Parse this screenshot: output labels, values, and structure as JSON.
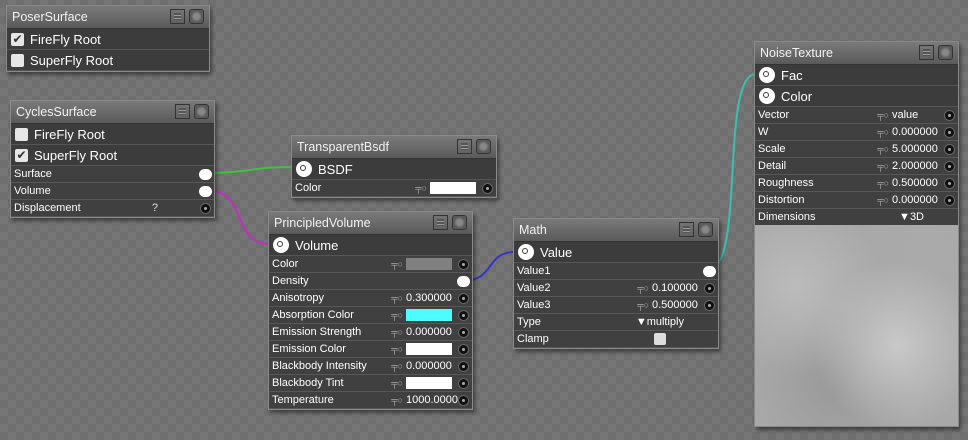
{
  "nodes": [
    {
      "title": "PoserSurface",
      "headers": [
        {
          "type": "checkbox",
          "label": "FireFly Root",
          "checked": true
        },
        {
          "type": "checkbox",
          "label": "SuperFly Root",
          "checked": false
        }
      ],
      "params": []
    },
    {
      "title": "CyclesSurface",
      "headers": [
        {
          "type": "checkbox",
          "label": "FireFly Root",
          "checked": false
        },
        {
          "type": "checkbox",
          "label": "SuperFly Root",
          "checked": true
        }
      ],
      "params": [
        {
          "label": "Surface",
          "socket": "output"
        },
        {
          "label": "Volume",
          "socket": "output"
        },
        {
          "label": "Displacement",
          "help": "?",
          "socket": "input"
        }
      ]
    },
    {
      "title": "TransparentBsdf",
      "headers": [
        {
          "type": "output",
          "label": "BSDF"
        }
      ],
      "params": [
        {
          "label": "Color",
          "key": true,
          "swatch": "#ffffff",
          "socket": "input"
        }
      ]
    },
    {
      "title": "PrincipledVolume",
      "headers": [
        {
          "type": "output",
          "label": "Volume"
        }
      ],
      "params": [
        {
          "label": "Color",
          "key": true,
          "swatch": "#808080",
          "socket": "input"
        },
        {
          "label": "Density",
          "socket": "output"
        },
        {
          "label": "Anisotropy",
          "key": true,
          "value": "0.300000",
          "socket": "input"
        },
        {
          "label": "Absorption Color",
          "key": true,
          "swatch": "#4dfcff",
          "socket": "input"
        },
        {
          "label": "Emission Strength",
          "key": true,
          "value": "0.000000",
          "socket": "input"
        },
        {
          "label": "Emission Color",
          "key": true,
          "swatch": "#ffffff",
          "socket": "input"
        },
        {
          "label": "Blackbody Intensity",
          "key": true,
          "value": "0.000000",
          "socket": "input"
        },
        {
          "label": "Blackbody Tint",
          "key": true,
          "swatch": "#ffffff",
          "socket": "input"
        },
        {
          "label": "Temperature",
          "key": true,
          "value": "1000.0000",
          "socket": "input"
        }
      ]
    },
    {
      "title": "Math",
      "headers": [
        {
          "type": "output",
          "label": "Value"
        }
      ],
      "params": [
        {
          "label": "Value1",
          "socket": "output"
        },
        {
          "label": "Value2",
          "key": true,
          "value": "0.100000",
          "socket": "input"
        },
        {
          "label": "Value3",
          "key": true,
          "value": "0.500000",
          "socket": "input"
        },
        {
          "label": "Type",
          "dropdown": "multiply"
        },
        {
          "label": "Clamp",
          "checkbox": false
        }
      ]
    },
    {
      "title": "NoiseTexture",
      "headers": [
        {
          "type": "output",
          "label": "Fac"
        },
        {
          "type": "output",
          "label": "Color"
        }
      ],
      "params": [
        {
          "label": "Vector",
          "key": true,
          "value": "value",
          "socket": "input"
        },
        {
          "label": "W",
          "key": true,
          "value": "0.000000",
          "socket": "input"
        },
        {
          "label": "Scale",
          "key": true,
          "value": "5.000000",
          "socket": "input"
        },
        {
          "label": "Detail",
          "key": true,
          "value": "2.000000",
          "socket": "input"
        },
        {
          "label": "Roughness",
          "key": true,
          "value": "0.500000",
          "socket": "input"
        },
        {
          "label": "Distortion",
          "key": true,
          "value": "0.000000",
          "socket": "input"
        },
        {
          "label": "Dimensions",
          "dropdown": "3D"
        }
      ],
      "preview": true
    }
  ],
  "wire_colors": {
    "surface": "#3cc43c",
    "volume": "#c030c0",
    "density": "#3434c8",
    "value1": "#38c0b0"
  }
}
